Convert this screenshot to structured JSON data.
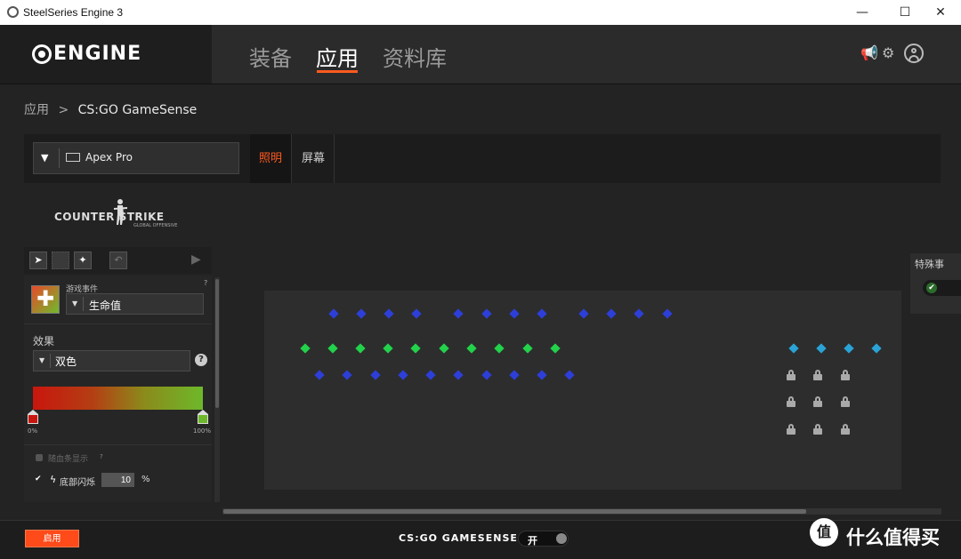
{
  "window": {
    "title": "SteelSeries Engine 3",
    "minimize": "—",
    "maximize": "☐",
    "close": "✕"
  },
  "header": {
    "logo_text": "ENGINE",
    "tabs": [
      {
        "label": "装备",
        "active": false
      },
      {
        "label": "应用",
        "active": true
      },
      {
        "label": "资料库",
        "active": false
      }
    ],
    "accent_color": "#ff5a1f"
  },
  "breadcrumb": {
    "parent": "应用",
    "separator": ">",
    "current": "CS:GO GameSense"
  },
  "device_bar": {
    "device_name": "Apex Pro",
    "tabs": [
      {
        "label": "照明",
        "active": true
      },
      {
        "label": "屏幕",
        "active": false
      }
    ]
  },
  "left_panel": {
    "game_logo_text": "COUNTER STRIKE",
    "game_logo_sub": "GLOBAL OFFENSIVE",
    "event": {
      "label": "游戏事件",
      "value": "生命值",
      "help": "?"
    },
    "effect": {
      "label": "效果",
      "value": "双色",
      "help": "?"
    },
    "gradient": {
      "start_color": "#c8160e",
      "end_color": "#6db82a",
      "min_label": "0%",
      "max_label": "100%"
    },
    "options": {
      "checkbox1_label": "随血条显示",
      "checkbox1_help": "?",
      "checkbox1_checked": false,
      "checkbox2_label": "底部闪烁",
      "checkbox2_checked": true,
      "flash_value": "10",
      "flash_unit": "%"
    }
  },
  "right_panel": {
    "label": "特殊事"
  },
  "bottom_bar": {
    "enable_button": "启用",
    "gamesense_label": "CS:GO GAMESENSE",
    "toggle_label": "开",
    "toggle_on": true
  },
  "watermark": {
    "icon": "值",
    "text": "什么值得买"
  }
}
